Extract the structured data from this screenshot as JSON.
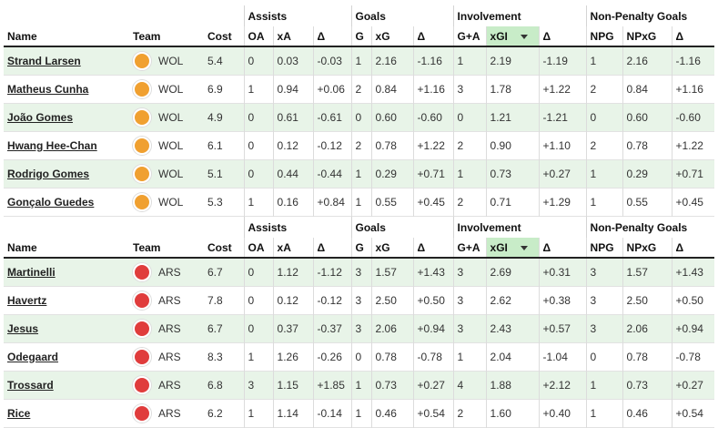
{
  "headers": {
    "groups": {
      "assists": "Assists",
      "goals": "Goals",
      "involvement": "Involvement",
      "npg": "Non-Penalty Goals"
    },
    "cols": [
      "Name",
      "Team",
      "Cost",
      "OA",
      "xA",
      "Δ",
      "G",
      "xG",
      "Δ",
      "G+A",
      "xGI",
      "Δ",
      "NPG",
      "NPxG",
      "Δ"
    ]
  },
  "colors": {
    "wol": "#f0a030",
    "ars": "#e03c3c",
    "alt_row": "#e8f4e8",
    "sorted_header": "#c8ecc8"
  },
  "tables": [
    {
      "rows": [
        [
          "Strand Larsen",
          "WOL",
          "5.4",
          "0",
          "0.03",
          "-0.03",
          "1",
          "2.16",
          "-1.16",
          "1",
          "2.19",
          "-1.19",
          "1",
          "2.16",
          "-1.16"
        ],
        [
          "Matheus Cunha",
          "WOL",
          "6.9",
          "1",
          "0.94",
          "+0.06",
          "2",
          "0.84",
          "+1.16",
          "3",
          "1.78",
          "+1.22",
          "2",
          "0.84",
          "+1.16"
        ],
        [
          "João Gomes",
          "WOL",
          "4.9",
          "0",
          "0.61",
          "-0.61",
          "0",
          "0.60",
          "-0.60",
          "0",
          "1.21",
          "-1.21",
          "0",
          "0.60",
          "-0.60"
        ],
        [
          "Hwang Hee-Chan",
          "WOL",
          "6.1",
          "0",
          "0.12",
          "-0.12",
          "2",
          "0.78",
          "+1.22",
          "2",
          "0.90",
          "+1.10",
          "2",
          "0.78",
          "+1.22"
        ],
        [
          "Rodrigo Gomes",
          "WOL",
          "5.1",
          "0",
          "0.44",
          "-0.44",
          "1",
          "0.29",
          "+0.71",
          "1",
          "0.73",
          "+0.27",
          "1",
          "0.29",
          "+0.71"
        ],
        [
          "Gonçalo Guedes",
          "WOL",
          "5.3",
          "1",
          "0.16",
          "+0.84",
          "1",
          "0.55",
          "+0.45",
          "2",
          "0.71",
          "+1.29",
          "1",
          "0.55",
          "+0.45"
        ]
      ]
    },
    {
      "rows": [
        [
          "Martinelli",
          "ARS",
          "6.7",
          "0",
          "1.12",
          "-1.12",
          "3",
          "1.57",
          "+1.43",
          "3",
          "2.69",
          "+0.31",
          "3",
          "1.57",
          "+1.43"
        ],
        [
          "Havertz",
          "ARS",
          "7.8",
          "0",
          "0.12",
          "-0.12",
          "3",
          "2.50",
          "+0.50",
          "3",
          "2.62",
          "+0.38",
          "3",
          "2.50",
          "+0.50"
        ],
        [
          "Jesus",
          "ARS",
          "6.7",
          "0",
          "0.37",
          "-0.37",
          "3",
          "2.06",
          "+0.94",
          "3",
          "2.43",
          "+0.57",
          "3",
          "2.06",
          "+0.94"
        ],
        [
          "Odegaard",
          "ARS",
          "8.3",
          "1",
          "1.26",
          "-0.26",
          "0",
          "0.78",
          "-0.78",
          "1",
          "2.04",
          "-1.04",
          "0",
          "0.78",
          "-0.78"
        ],
        [
          "Trossard",
          "ARS",
          "6.8",
          "3",
          "1.15",
          "+1.85",
          "1",
          "0.73",
          "+0.27",
          "4",
          "1.88",
          "+2.12",
          "1",
          "0.73",
          "+0.27"
        ],
        [
          "Rice",
          "ARS",
          "6.2",
          "1",
          "1.14",
          "-0.14",
          "1",
          "0.46",
          "+0.54",
          "2",
          "1.60",
          "+0.40",
          "1",
          "0.46",
          "+0.54"
        ]
      ]
    }
  ]
}
